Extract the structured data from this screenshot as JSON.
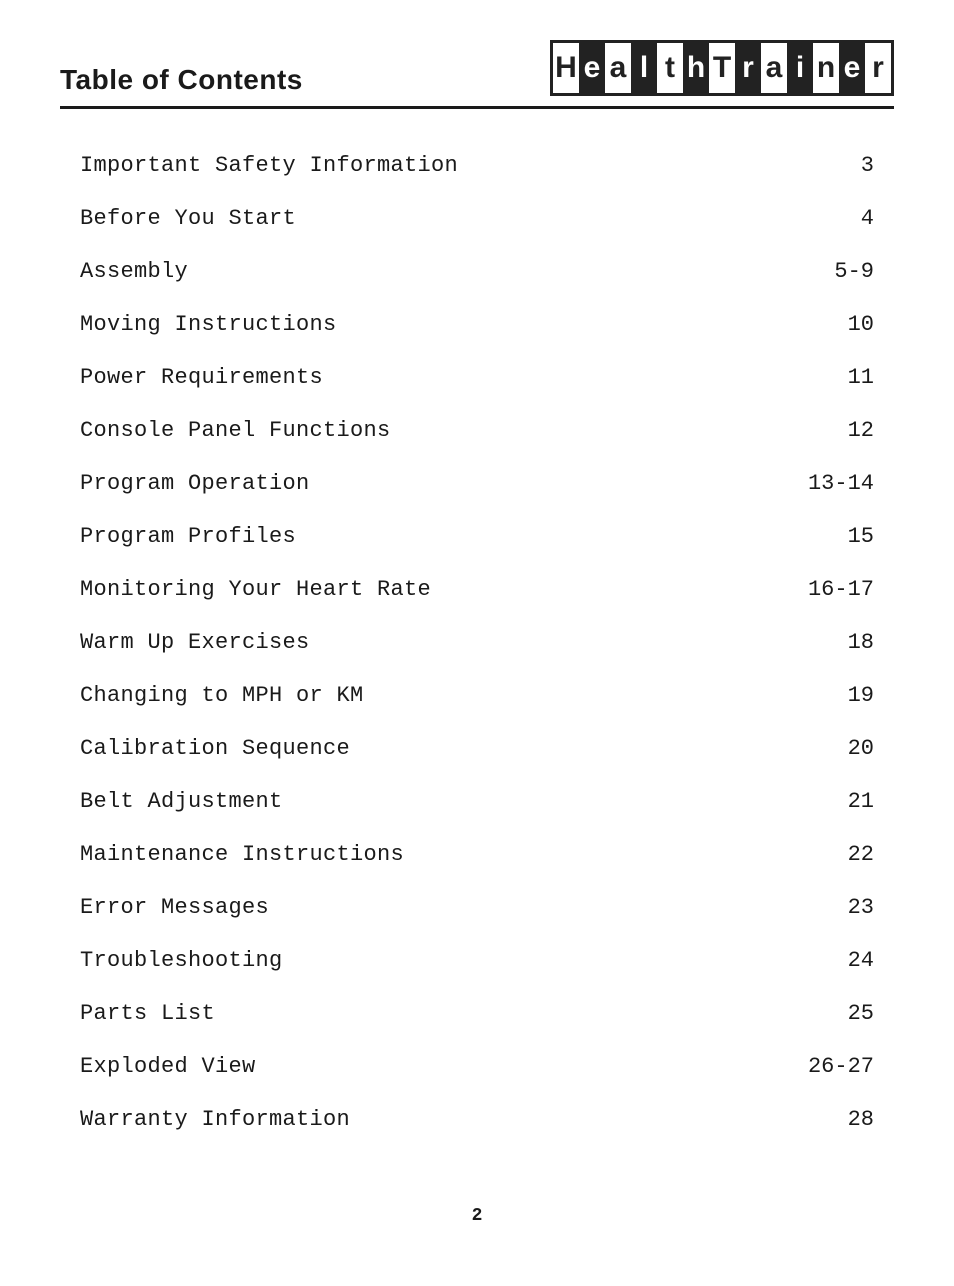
{
  "header": {
    "title": "Table of Contents",
    "logo_letters": [
      "H",
      "e",
      "a",
      "l",
      "t",
      "h",
      "T",
      "r",
      "a",
      "i",
      "n",
      "e",
      "r"
    ]
  },
  "toc": {
    "items": [
      {
        "label": "Important Safety Information",
        "page": "3"
      },
      {
        "label": "Before You Start",
        "page": "4"
      },
      {
        "label": "Assembly",
        "page": "5-9"
      },
      {
        "label": "Moving Instructions",
        "page": "10"
      },
      {
        "label": "Power Requirements",
        "page": "11"
      },
      {
        "label": "Console Panel Functions",
        "page": "12"
      },
      {
        "label": "Program Operation",
        "page": "13-14"
      },
      {
        "label": "Program Profiles",
        "page": "15"
      },
      {
        "label": "Monitoring Your Heart Rate",
        "page": "16-17"
      },
      {
        "label": "Warm Up Exercises",
        "page": "18"
      },
      {
        "label": "Changing to MPH or KM",
        "page": "19"
      },
      {
        "label": "Calibration Sequence",
        "page": "20"
      },
      {
        "label": "Belt Adjustment",
        "page": "21"
      },
      {
        "label": "Maintenance Instructions",
        "page": "22"
      },
      {
        "label": "Error Messages",
        "page": "23"
      },
      {
        "label": "Troubleshooting",
        "page": "24"
      },
      {
        "label": "Parts List",
        "page": "25"
      },
      {
        "label": "Exploded View",
        "page": "26-27"
      },
      {
        "label": "Warranty Information",
        "page": "28"
      }
    ]
  },
  "footer": {
    "page_number": "2"
  }
}
